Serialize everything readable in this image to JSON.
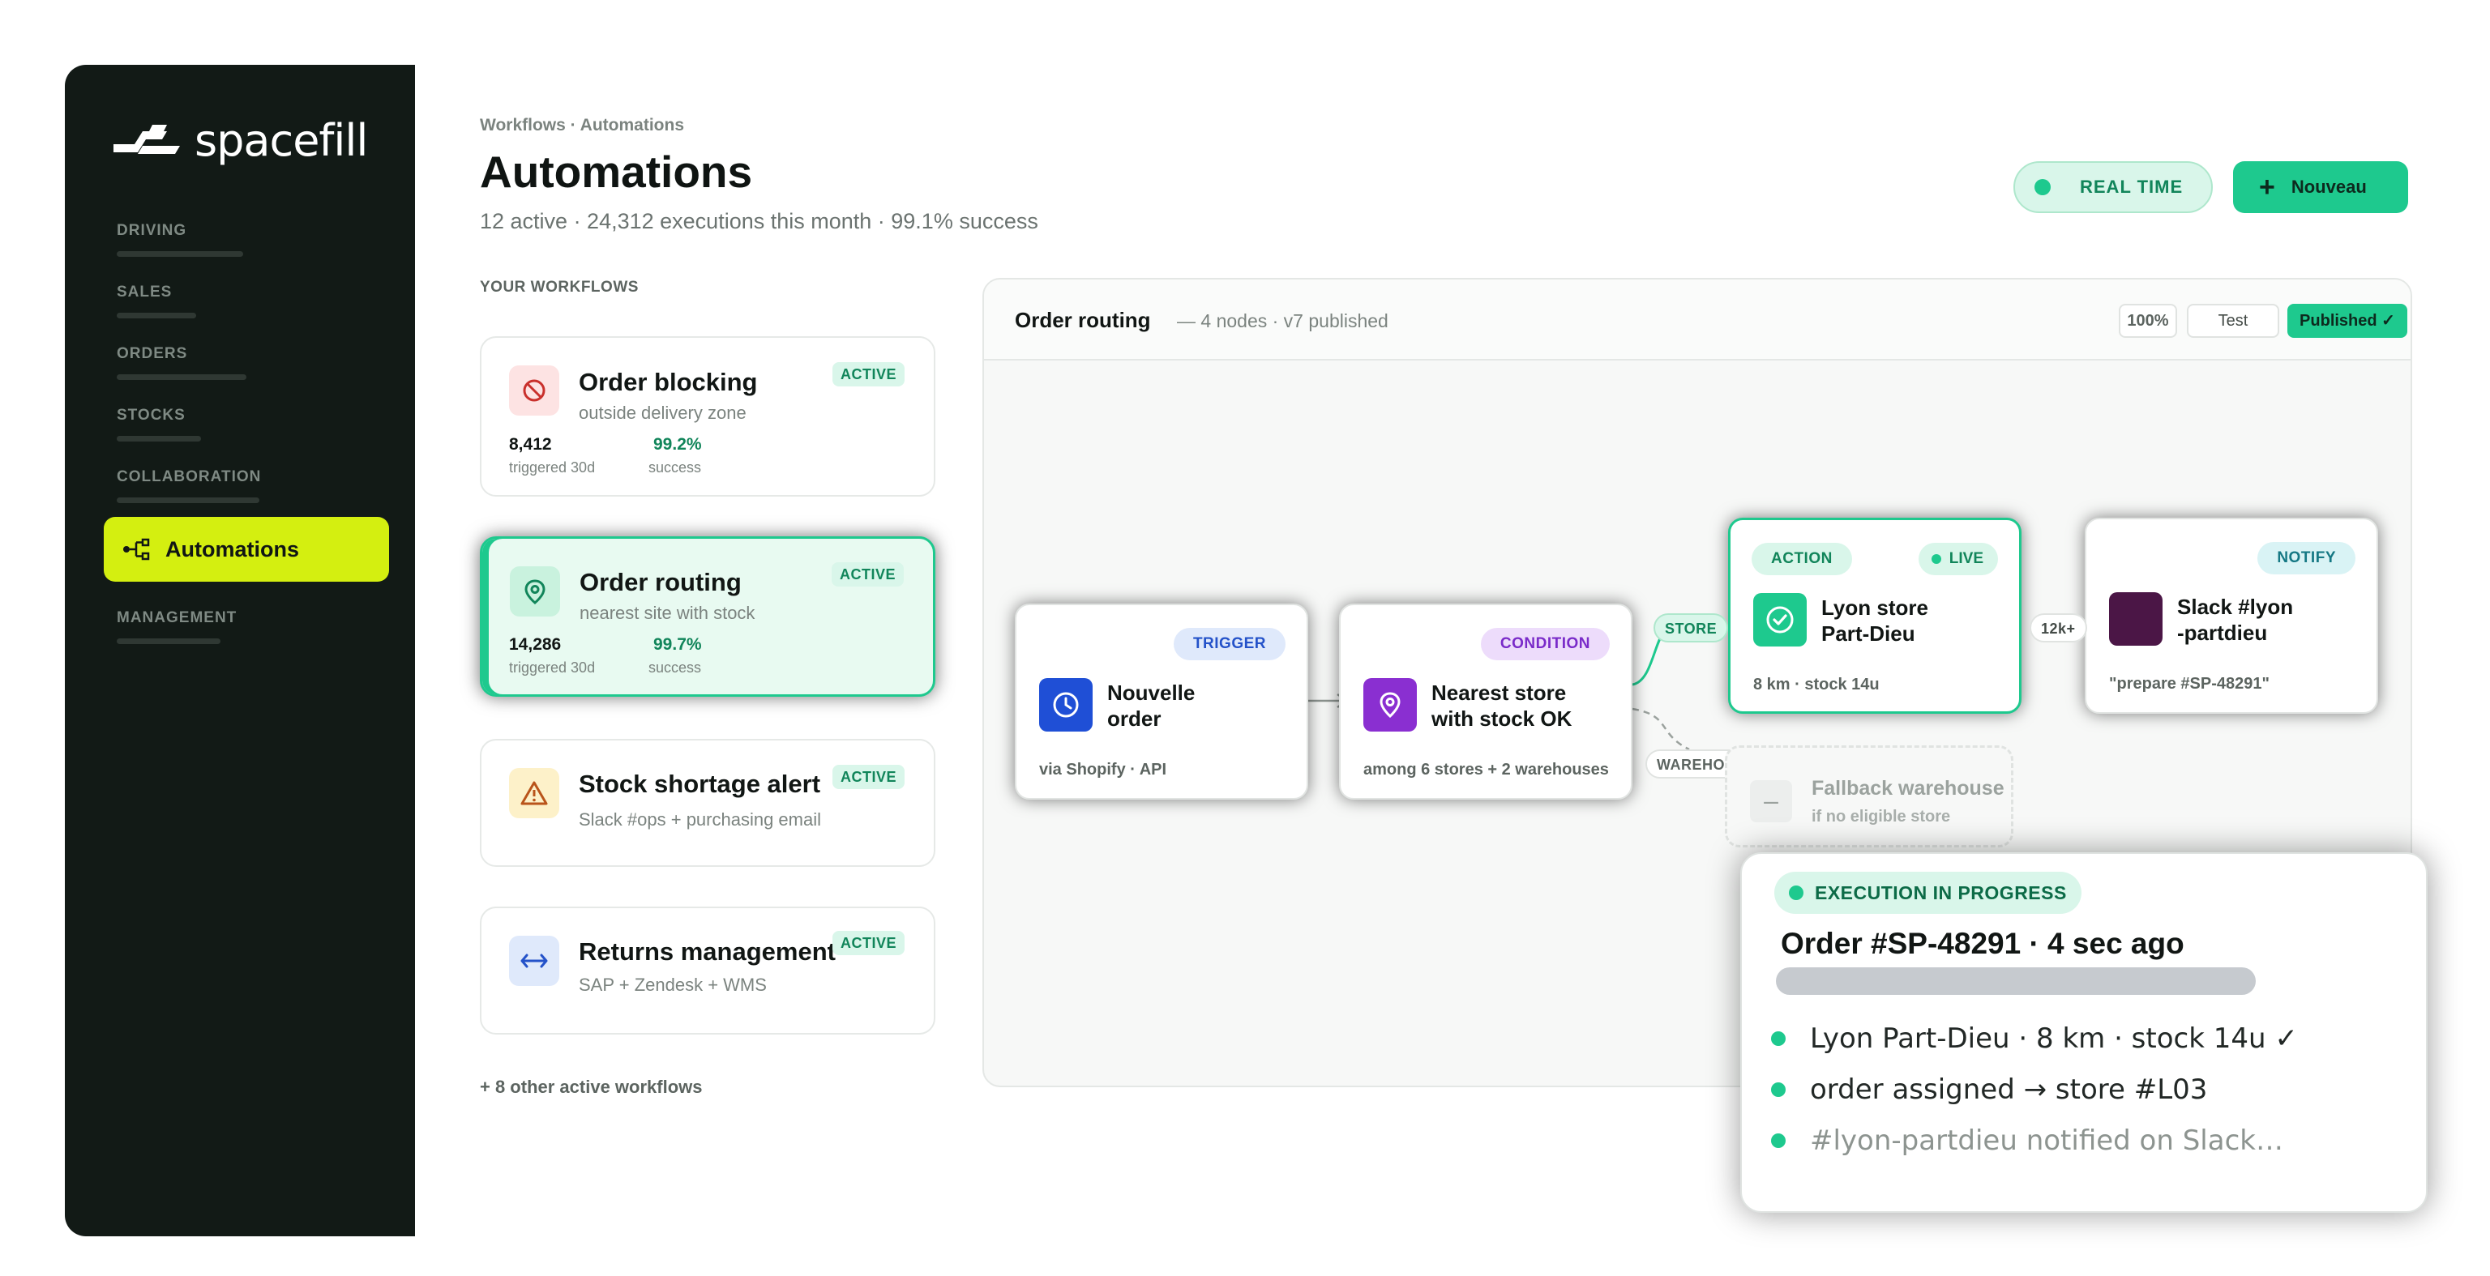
{
  "brand": {
    "name": "spacefill"
  },
  "sidebar": {
    "sections": [
      {
        "label": "DRIVING"
      },
      {
        "label": "SALES"
      },
      {
        "label": "ORDERS"
      },
      {
        "label": "STOCKS"
      },
      {
        "label": "COLLABORATION"
      },
      {
        "label": "MANAGEMENT"
      }
    ],
    "active_item": {
      "label": "Automations",
      "icon": "workflow-icon"
    },
    "accent": "#d4ef10"
  },
  "header": {
    "breadcrumb": "Workflows · Automations",
    "title": "Automations",
    "subtitle": "12 active · 24,312 executions this month · 99.1% success",
    "realtime_label": "REAL TIME",
    "new_button_label": "Nouveau",
    "accent": "#1ec98e"
  },
  "workflows": {
    "heading": "YOUR WORKFLOWS",
    "items": [
      {
        "title": "Order blocking",
        "subtitle": "outside delivery zone",
        "badge": "ACTIVE",
        "icon": "block-icon",
        "triggered": "8,412",
        "triggered_caption": "triggered 30d",
        "success": "99.2%",
        "success_caption": "success"
      },
      {
        "title": "Order routing",
        "subtitle": "nearest site with stock",
        "badge": "ACTIVE",
        "icon": "location-pin-icon",
        "triggered": "14,286",
        "triggered_caption": "triggered 30d",
        "success": "99.7%",
        "success_caption": "success"
      },
      {
        "title": "Stock shortage alert",
        "subtitle": "Slack #ops + purchasing email",
        "badge": "ACTIVE",
        "icon": "warning-icon"
      },
      {
        "title": "Returns management",
        "subtitle": "SAP + Zendesk + WMS",
        "badge": "ACTIVE",
        "icon": "swap-arrows-icon"
      }
    ],
    "more": "+ 8 other active workflows"
  },
  "canvas": {
    "title": "Order routing",
    "meta": "— 4 nodes · v7 published",
    "zoom": "100%",
    "test_label": "Test",
    "published_label": "Published ✓",
    "nodes": {
      "trigger": {
        "chip": "TRIGGER",
        "title_1": "Nouvelle",
        "title_2": "order",
        "foot": "via Shopify · API",
        "icon": "clock-icon"
      },
      "condition": {
        "chip": "CONDITION",
        "title_1": "Nearest store",
        "title_2": "with stock OK",
        "foot": "among 6 stores + 2 warehouses",
        "icon": "location-pin-icon"
      },
      "action": {
        "chip": "ACTION",
        "live": "LIVE",
        "title_1": "Lyon store",
        "title_2": "Part-Dieu",
        "foot": "8 km · stock 14u",
        "icon": "check-circle-icon"
      },
      "notify": {
        "chip": "NOTIFY",
        "title_1": "Slack #lyon",
        "title_2": "-partdieu",
        "foot": "\"prepare #SP-48291\"",
        "icon": "slack-avatar"
      }
    },
    "edge_labels": {
      "store": "STORE",
      "warehouse": "WAREHOUSE",
      "volume": "12k+"
    },
    "fallback": {
      "title": "Fallback warehouse",
      "subtitle": "if no eligible store"
    }
  },
  "execution": {
    "status": "EXECUTION IN PROGRESS",
    "title": "Order #SP-48291 · 4 sec ago",
    "steps": [
      {
        "text": "Lyon Part-Dieu · 8 km · stock 14u ✓"
      },
      {
        "text": "order assigned → store #L03"
      },
      {
        "text": "#lyon-partdieu notified on Slack…"
      }
    ]
  }
}
